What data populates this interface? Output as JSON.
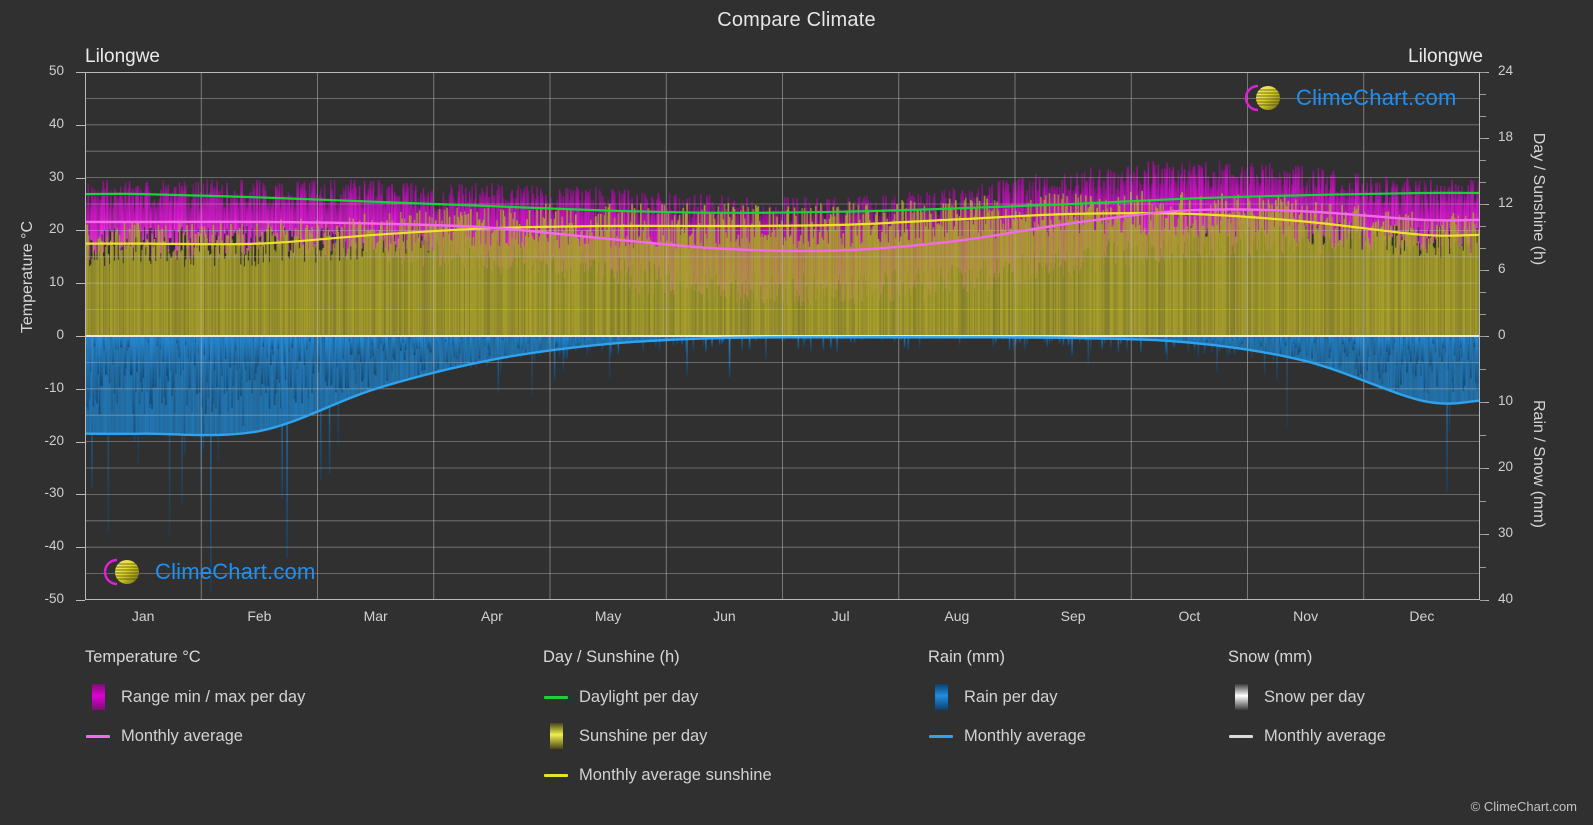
{
  "title": "Compare Climate",
  "station_left": "Lilongwe",
  "station_right": "Lilongwe",
  "copyright": "© ClimeChart.com",
  "logo": {
    "text": "ClimeChart.com",
    "arc_color": "#e020d8",
    "sphere_color": "#d8cc20",
    "text_color": "#1e90f5"
  },
  "axes": {
    "left_title": "Temperature °C",
    "right_top_title": "Day / Sunshine (h)",
    "right_bottom_title": "Rain / Snow (mm)",
    "left_ticks": [
      "50",
      "40",
      "30",
      "20",
      "10",
      "0",
      "-10",
      "-20",
      "-30",
      "-40",
      "-50"
    ],
    "right_top_ticks": [
      "24",
      "18",
      "12",
      "6",
      "0"
    ],
    "right_bottom_ticks": [
      "0",
      "10",
      "20",
      "30",
      "40"
    ],
    "x_ticks": [
      "Jan",
      "Feb",
      "Mar",
      "Apr",
      "May",
      "Jun",
      "Jul",
      "Aug",
      "Sep",
      "Oct",
      "Nov",
      "Dec"
    ]
  },
  "legend": [
    {
      "heading": "Temperature °C",
      "items": [
        {
          "label": "Range min / max per day",
          "key": "swatch",
          "color": "#e100d8",
          "color2": "#7a0f72"
        },
        {
          "label": "Monthly average",
          "key": "line",
          "color": "#f36ae8"
        }
      ]
    },
    {
      "heading": "Day / Sunshine (h)",
      "items": [
        {
          "label": "Daylight per day",
          "key": "line",
          "color": "#18d33a"
        },
        {
          "label": "Sunshine per day",
          "key": "swatch",
          "color": "#efef4e",
          "color2": "#4a4417"
        },
        {
          "label": "Monthly average sunshine",
          "key": "line",
          "color": "#ece22a"
        }
      ]
    },
    {
      "heading": "Rain (mm)",
      "items": [
        {
          "label": "Rain per day",
          "key": "swatch",
          "color": "#1f8ee0",
          "color2": "#0d3f6b"
        },
        {
          "label": "Monthly average",
          "key": "line",
          "color": "#2ea3ee"
        }
      ]
    },
    {
      "heading": "Snow (mm)",
      "items": [
        {
          "label": "Snow per day",
          "key": "swatch",
          "color": "#ffffff",
          "color2": "#3a3a3a"
        },
        {
          "label": "Monthly average",
          "key": "line",
          "color": "#d9d9d9"
        }
      ]
    }
  ],
  "chart_data": {
    "type": "area",
    "title": "Compare Climate",
    "subtitle": "Lilongwe",
    "xlabel": "",
    "ylabel": "Temperature °C",
    "grid": true,
    "legend_position": "below",
    "x": [
      "Jan",
      "Feb",
      "Mar",
      "Apr",
      "May",
      "Jun",
      "Jul",
      "Aug",
      "Sep",
      "Oct",
      "Nov",
      "Dec"
    ],
    "axis_ranges": {
      "temperature_c": [
        -50,
        50
      ],
      "day_sunshine_h": [
        0,
        24
      ],
      "rain_snow_mm": [
        0,
        40
      ]
    },
    "series": [
      {
        "name": "Monthly average temperature",
        "unit": "°C",
        "axis": "temperature_c",
        "color": "#f36ae8",
        "values": [
          21.6,
          21.6,
          21.3,
          20.5,
          18.4,
          16.5,
          16.2,
          18.0,
          21.4,
          23.8,
          23.6,
          22.0
        ]
      },
      {
        "name": "Range min / max per day (temperature band)",
        "unit": "°C",
        "axis": "temperature_c",
        "color": "#e100d8",
        "min_values": [
          17.5,
          17.6,
          17.0,
          15.2,
          12.0,
          9.4,
          9.0,
          10.6,
          14.4,
          17.6,
          18.6,
          17.8
        ],
        "max_values": [
          26.8,
          26.9,
          26.8,
          26.2,
          25.4,
          24.0,
          23.6,
          25.6,
          28.8,
          30.6,
          29.4,
          27.2
        ]
      },
      {
        "name": "Daylight per day",
        "unit": "h",
        "axis": "day_sunshine_h",
        "color": "#18d33a",
        "values": [
          12.9,
          12.6,
          12.2,
          11.8,
          11.4,
          11.2,
          11.3,
          11.6,
          12.0,
          12.5,
          12.8,
          13.0
        ]
      },
      {
        "name": "Monthly average sunshine",
        "unit": "h",
        "axis": "day_sunshine_h",
        "color": "#ece22a",
        "values": [
          8.4,
          8.4,
          9.2,
          9.8,
          10.0,
          10.0,
          10.1,
          10.6,
          11.1,
          11.1,
          10.4,
          9.2
        ]
      },
      {
        "name": "Sunshine per day (band)",
        "unit": "h",
        "axis": "day_sunshine_h",
        "color": "#a3a32c",
        "values": [
          8.4,
          8.4,
          9.2,
          9.8,
          10.0,
          10.0,
          10.1,
          10.6,
          11.1,
          11.1,
          10.4,
          9.2
        ]
      },
      {
        "name": "Rain monthly average",
        "unit": "mm",
        "axis": "rain_snow_mm",
        "color": "#2ea3ee",
        "values": [
          14.8,
          14.4,
          8.0,
          3.6,
          1.2,
          0.3,
          0.2,
          0.2,
          0.3,
          1.0,
          3.8,
          9.8
        ]
      },
      {
        "name": "Snow monthly average",
        "unit": "mm",
        "axis": "rain_snow_mm",
        "color": "#d9d9d9",
        "values": [
          0,
          0,
          0,
          0,
          0,
          0,
          0,
          0,
          0,
          0,
          0,
          0
        ]
      }
    ]
  }
}
